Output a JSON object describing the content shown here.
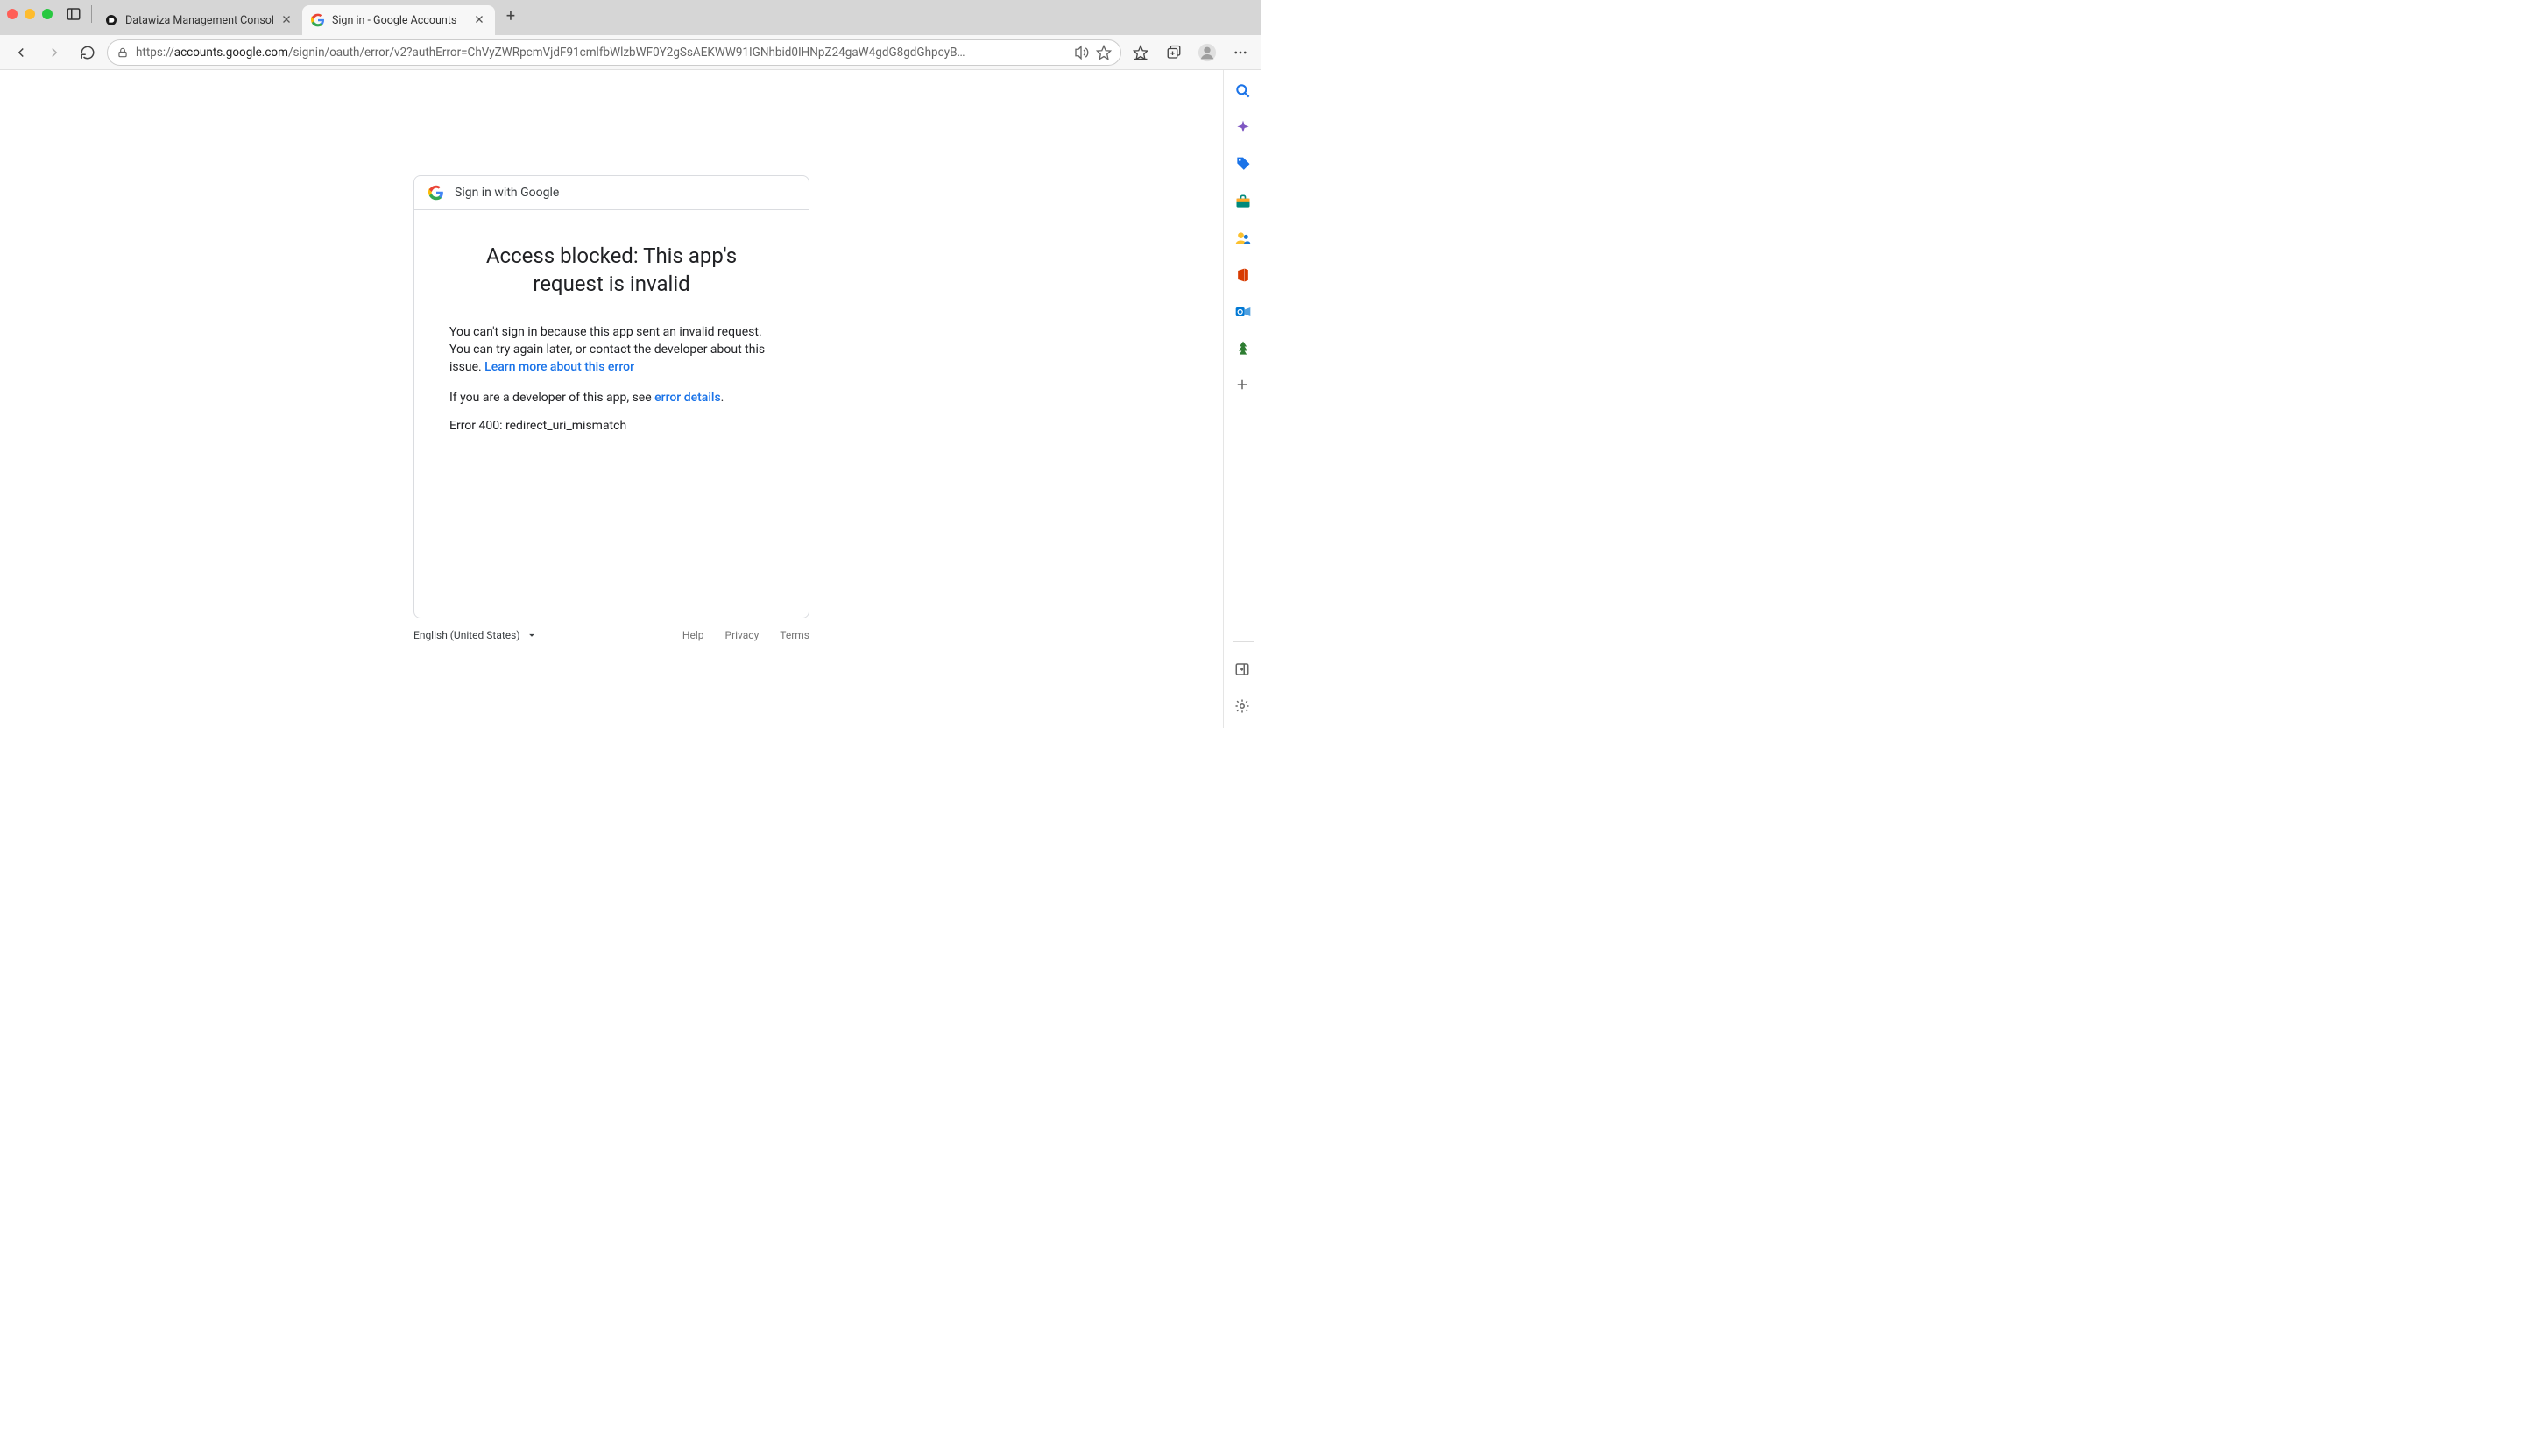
{
  "browser": {
    "tabs": [
      {
        "title": "Datawiza Management Consol",
        "active": false
      },
      {
        "title": "Sign in - Google Accounts",
        "active": true
      }
    ],
    "url_prefix": "https://",
    "url_host": "accounts.google.com",
    "url_path": "/signin/oauth/error/v2?authError=ChVyZWRpcmVjdF91cmlfbWlzbWF0Y2gSsAEKWW91IGNhbid0IHNpZ24gaW4gdG8gdGhpcyB…"
  },
  "card": {
    "header_text": "Sign in with Google",
    "title": "Access blocked: This app's request is invalid",
    "p1_before_link": "You can't sign in because this app sent an invalid request. You can try again later, or contact the developer about this issue. ",
    "p1_link": "Learn more about this error",
    "p2_before_link": "If you are a developer of this app, see ",
    "p2_link": "error details",
    "p2_after_link": ".",
    "error_code": "Error 400: redirect_uri_mismatch"
  },
  "footer": {
    "language": "English (United States)",
    "help": "Help",
    "privacy": "Privacy",
    "terms": "Terms"
  }
}
